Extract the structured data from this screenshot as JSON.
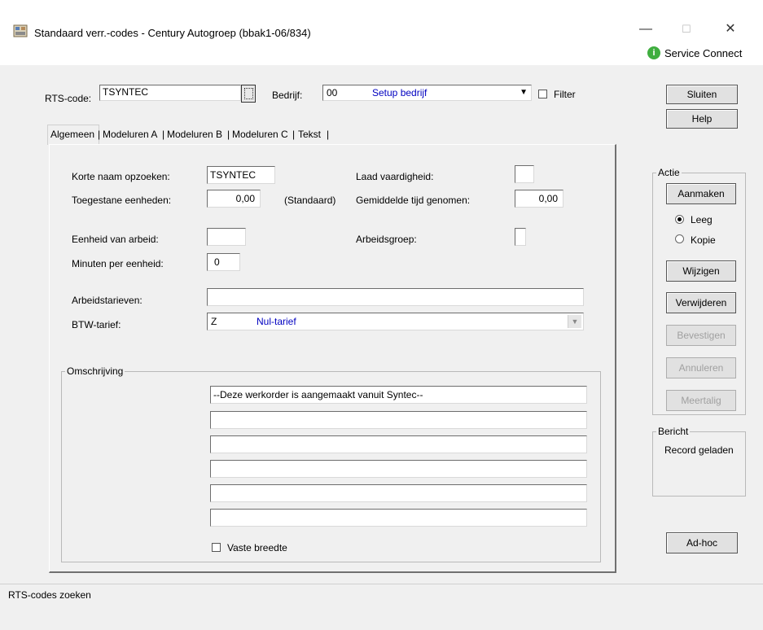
{
  "window": {
    "title": "Standaard verr.-codes - Century Autogroep (bbak1-06/834)",
    "minimize": "—",
    "maximize": "☐",
    "close": "✕",
    "service_connect": "Service Connect",
    "service_icon": "i"
  },
  "header": {
    "rts_label": "RTS-code:",
    "rts_value": "TSYNTEC",
    "bedrijf_label": "Bedrijf:",
    "bedrijf_code": "00",
    "bedrijf_name": "Setup bedrijf",
    "filter_label": "Filter"
  },
  "tabs": [
    "Algemeen",
    "Modeluren A",
    "Modeluren B",
    "Modeluren C",
    "Tekst"
  ],
  "general": {
    "korte_naam_label": "Korte naam opzoeken:",
    "korte_naam_value": "TSYNTEC",
    "toegestane_label": "Toegestane eenheden:",
    "toegestane_value": "0,00",
    "standaard_label": "(Standaard)",
    "laad_label": "Laad vaardigheid:",
    "laad_value": "",
    "gemiddelde_label": "Gemiddelde tijd genomen:",
    "gemiddelde_value": "0,00",
    "eenheid_label": "Eenheid van arbeid:",
    "eenheid_value": "",
    "arbeidsgroep_label": "Arbeidsgroep:",
    "arbeidsgroep_value": "",
    "minuten_label": "Minuten per eenheid:",
    "minuten_value": "0",
    "tarieven_label": "Arbeidstarieven:",
    "tarieven_value": "",
    "btw_label": "BTW-tarief:",
    "btw_code": "Z",
    "btw_name": "Nul-tarief"
  },
  "omschrijving": {
    "title": "Omschrijving",
    "lines": [
      "--Deze werkorder is aangemaakt vanuit Syntec--",
      "",
      "",
      "",
      "",
      ""
    ],
    "vaste_breedte_label": "Vaste breedte"
  },
  "side": {
    "sluiten": "Sluiten",
    "help": "Help",
    "actie_title": "Actie",
    "aanmaken": "Aanmaken",
    "leeg": "Leeg",
    "kopie": "Kopie",
    "wijzigen": "Wijzigen",
    "verwijderen": "Verwijderen",
    "bevestigen": "Bevestigen",
    "annuleren": "Annuleren",
    "meertalig": "Meertalig",
    "bericht_title": "Bericht",
    "bericht_text": "Record geladen",
    "adhoc": "Ad-hoc"
  },
  "statusbar": {
    "text": "RTS-codes zoeken"
  },
  "colors": {
    "accent_text": "#0000c0",
    "service_green": "#3fae3f"
  }
}
